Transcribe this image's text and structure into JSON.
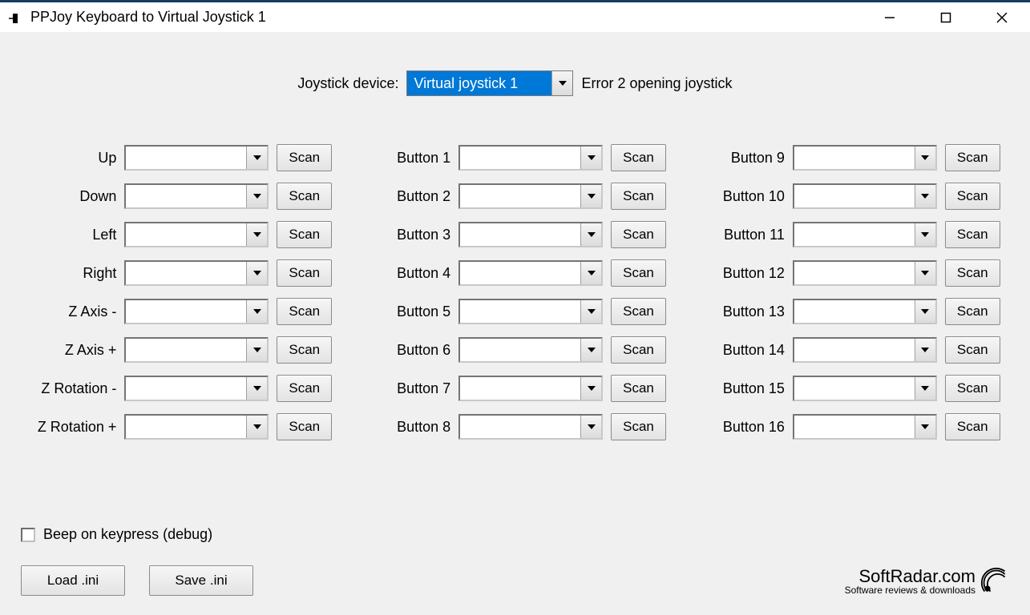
{
  "window": {
    "title": "PPJoy Keyboard to Virtual Joystick 1"
  },
  "top": {
    "device_label": "Joystick device:",
    "device_selected": "Virtual joystick 1",
    "error_text": "Error 2 opening joystick"
  },
  "scan_label": "Scan",
  "columns": {
    "col1": [
      {
        "label": "Up",
        "value": ""
      },
      {
        "label": "Down",
        "value": ""
      },
      {
        "label": "Left",
        "value": ""
      },
      {
        "label": "Right",
        "value": ""
      },
      {
        "label": "Z Axis -",
        "value": ""
      },
      {
        "label": "Z Axis +",
        "value": ""
      },
      {
        "label": "Z Rotation -",
        "value": ""
      },
      {
        "label": "Z Rotation +",
        "value": ""
      }
    ],
    "col2": [
      {
        "label": "Button 1",
        "value": ""
      },
      {
        "label": "Button 2",
        "value": ""
      },
      {
        "label": "Button 3",
        "value": ""
      },
      {
        "label": "Button 4",
        "value": ""
      },
      {
        "label": "Button 5",
        "value": ""
      },
      {
        "label": "Button 6",
        "value": ""
      },
      {
        "label": "Button 7",
        "value": ""
      },
      {
        "label": "Button 8",
        "value": ""
      }
    ],
    "col3": [
      {
        "label": "Button 9",
        "value": ""
      },
      {
        "label": "Button 10",
        "value": ""
      },
      {
        "label": "Button 11",
        "value": ""
      },
      {
        "label": "Button 12",
        "value": ""
      },
      {
        "label": "Button 13",
        "value": ""
      },
      {
        "label": "Button 14",
        "value": ""
      },
      {
        "label": "Button 15",
        "value": ""
      },
      {
        "label": "Button 16",
        "value": ""
      }
    ]
  },
  "bottom": {
    "beep_label": "Beep on keypress (debug)",
    "beep_checked": false,
    "load_label": "Load .ini",
    "save_label": "Save .ini"
  },
  "watermark": {
    "main": "SoftRadar.com",
    "sub": "Software reviews & downloads"
  }
}
